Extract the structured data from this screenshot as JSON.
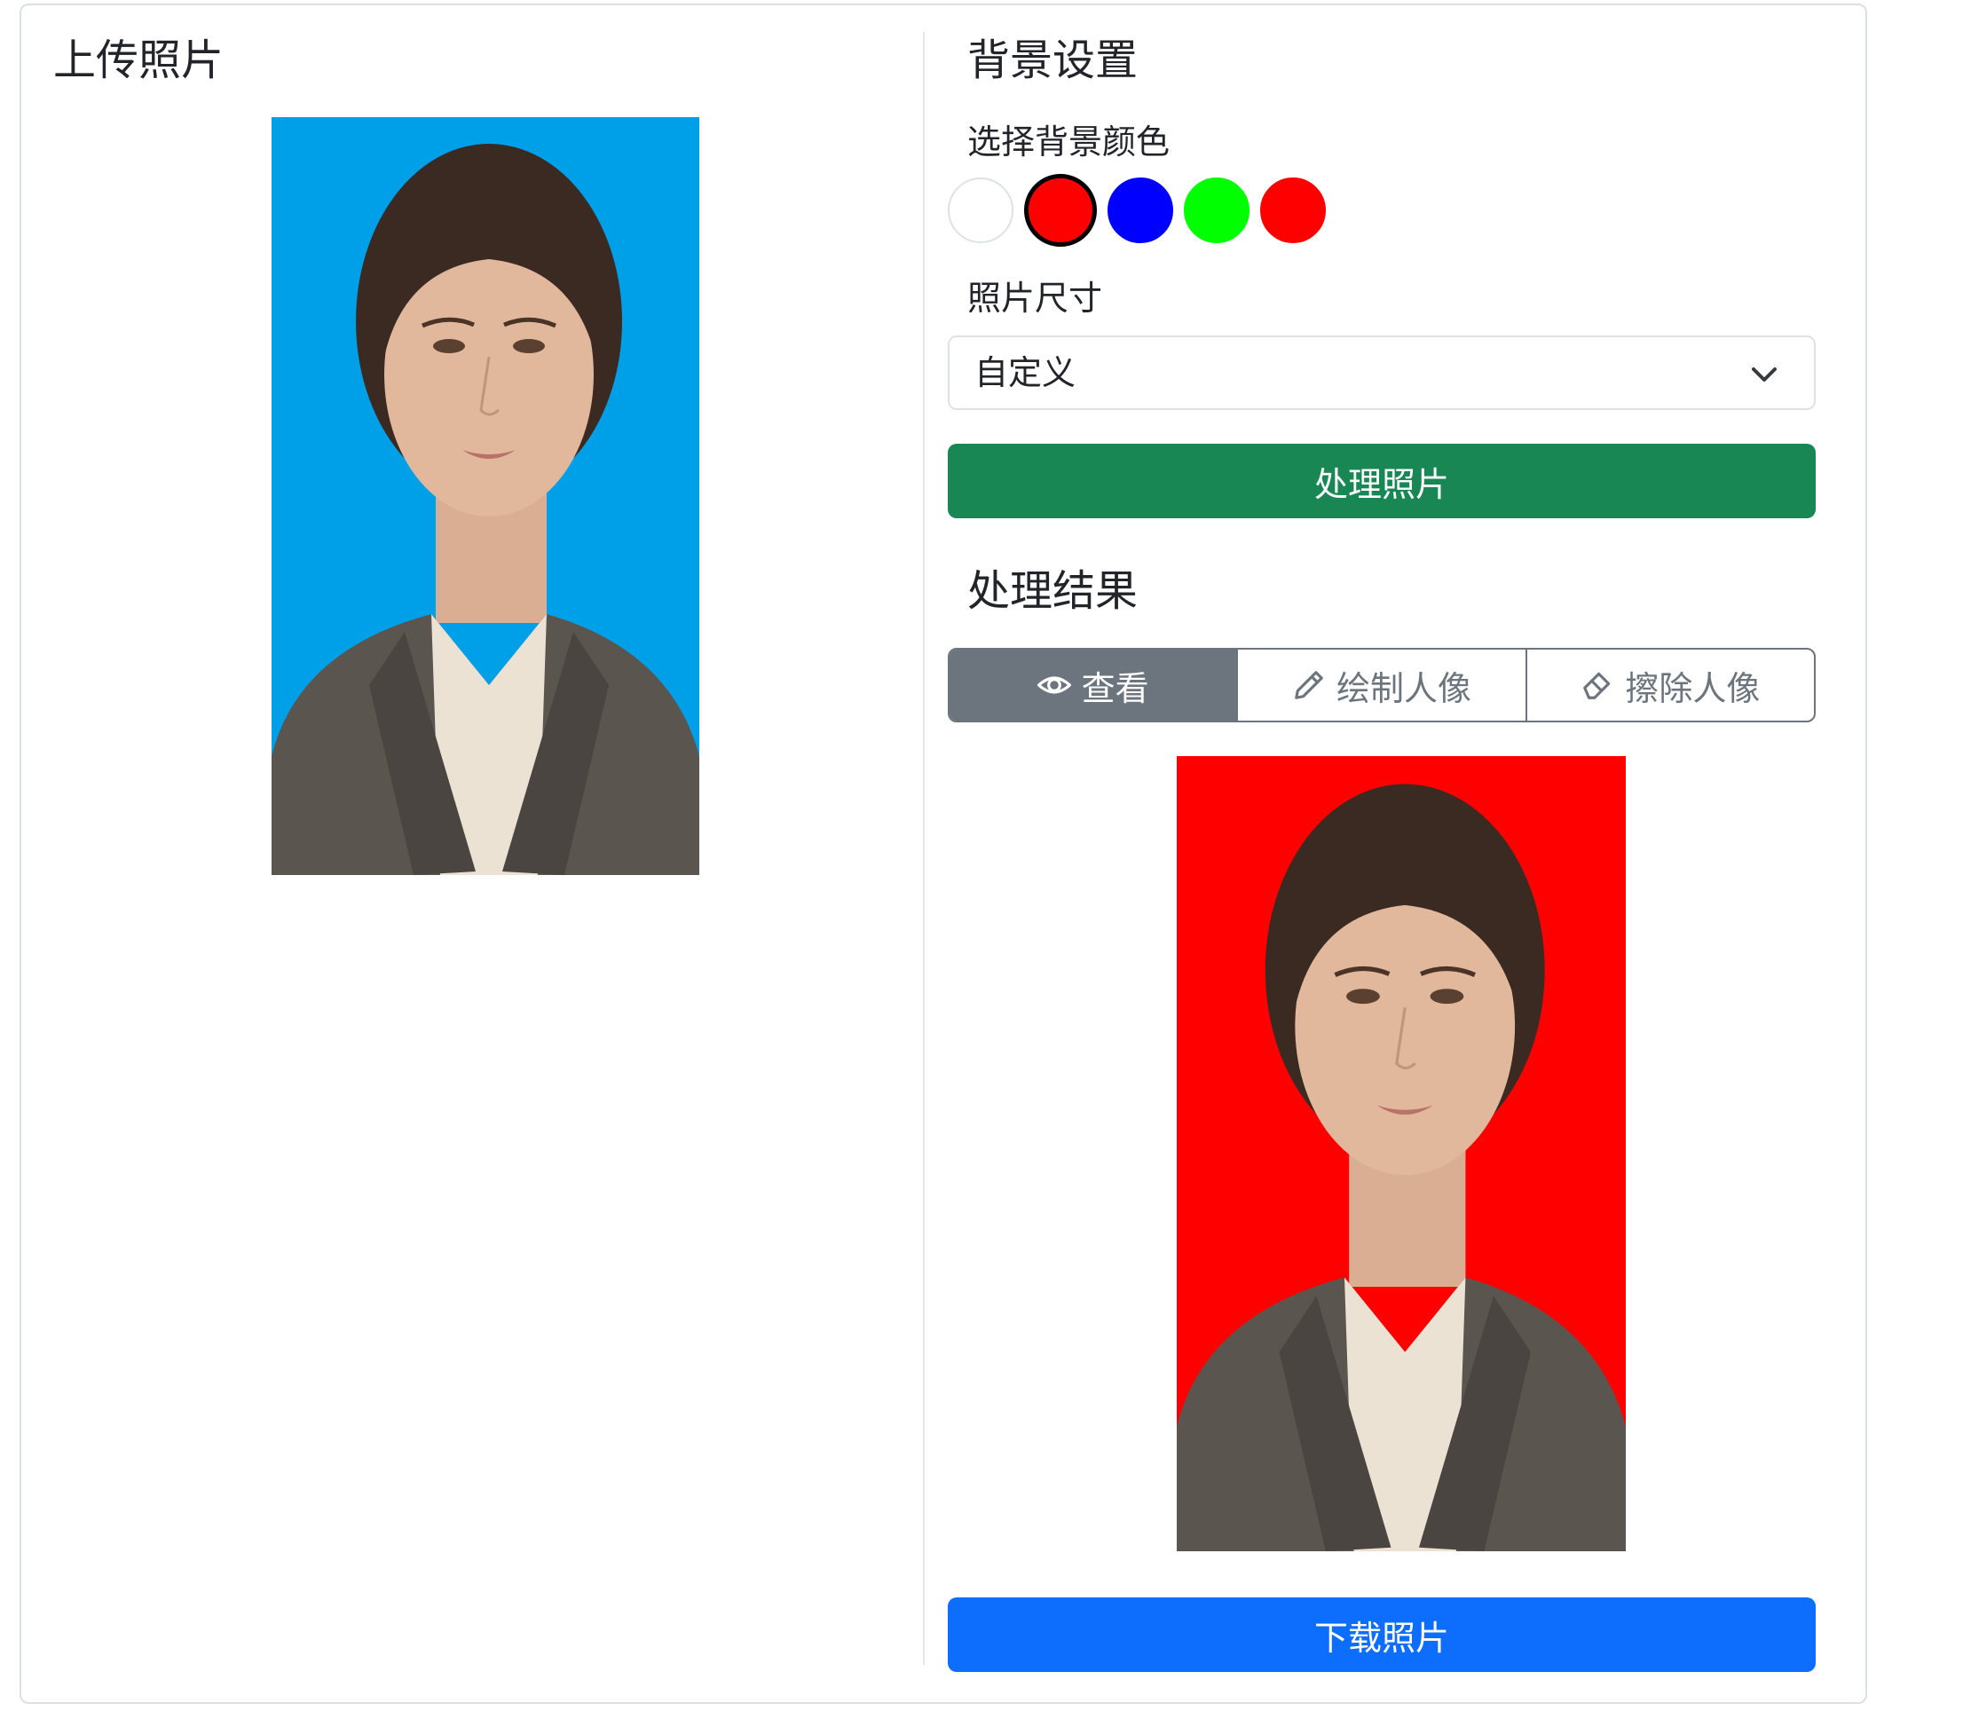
{
  "left_panel": {
    "title": "上传照片"
  },
  "right_panel": {
    "title": "背景设置",
    "color_label": "选择背景颜色",
    "colors": [
      {
        "name": "white",
        "hex": "#ffffff",
        "selected": false
      },
      {
        "name": "red",
        "hex": "#ff0000",
        "selected": true
      },
      {
        "name": "blue",
        "hex": "#0000ff",
        "selected": false
      },
      {
        "name": "green",
        "hex": "#00ff00",
        "selected": false
      },
      {
        "name": "red-2",
        "hex": "#ff0000",
        "selected": false
      }
    ],
    "size_label": "照片尺寸",
    "size_selected": "自定义",
    "process_button": "处理照片",
    "result_title": "处理结果",
    "tabs": [
      {
        "label": "查看",
        "icon": "eye-icon",
        "active": true
      },
      {
        "label": "绘制人像",
        "icon": "pencil-icon",
        "active": false
      },
      {
        "label": "擦除人像",
        "icon": "eraser-icon",
        "active": false
      }
    ],
    "download_button": "下载照片"
  },
  "colors": {
    "original_bg": "#00a0e8",
    "result_bg": "#ff0000",
    "process_btn": "#198754",
    "download_btn": "#0d6efd"
  }
}
